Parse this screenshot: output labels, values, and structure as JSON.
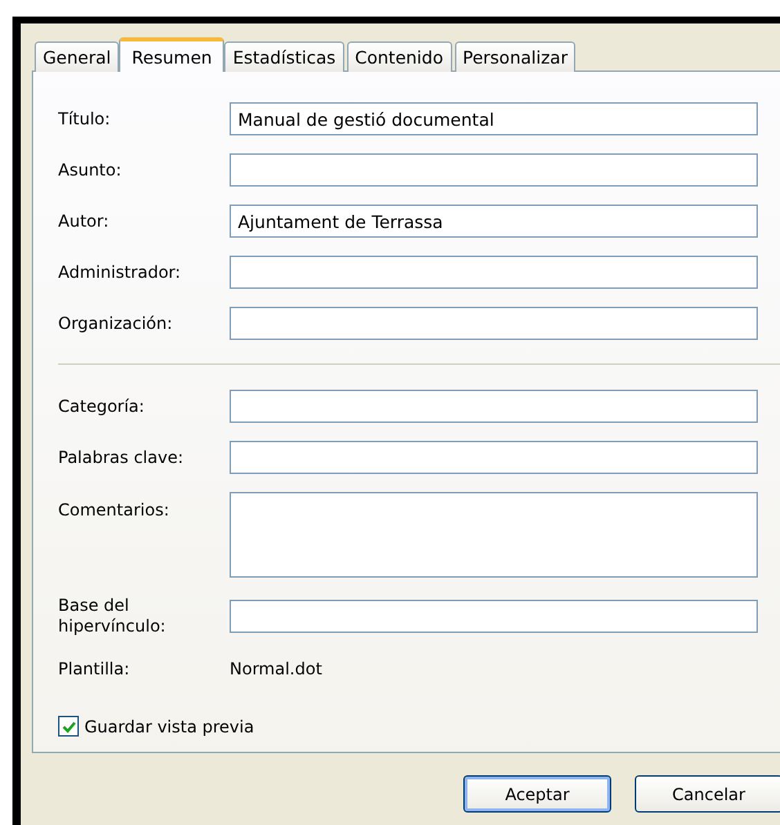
{
  "tabs": [
    {
      "label": "General",
      "selected": false
    },
    {
      "label": "Resumen",
      "selected": true
    },
    {
      "label": "Estadísticas",
      "selected": false
    },
    {
      "label": "Contenido",
      "selected": false
    },
    {
      "label": "Personalizar",
      "selected": false
    }
  ],
  "fields_top": [
    {
      "kind": "text",
      "label": "Título:",
      "value": "Manual de gestió documental"
    },
    {
      "kind": "text",
      "label": "Asunto:"
    },
    {
      "kind": "text",
      "label": "Autor:",
      "value": "Ajuntament de Terrassa"
    },
    {
      "kind": "text",
      "label": "Administrador:"
    },
    {
      "kind": "text",
      "label": "Organización:"
    }
  ],
  "fields_bottom": [
    {
      "kind": "text",
      "label": "Categoría:"
    },
    {
      "kind": "text",
      "label": "Palabras clave:"
    },
    {
      "kind": "textarea",
      "label": "Comentarios:"
    },
    {
      "kind": "text",
      "label": "Base del hipervínculo:"
    },
    {
      "kind": "static",
      "label": "Plantilla:",
      "value": "Normal.dot"
    }
  ],
  "preview_checkbox": {
    "label": "Guardar vista previa",
    "checked": true
  },
  "buttons": [
    {
      "label": "Aceptar",
      "default": true
    },
    {
      "label": "Cancelar",
      "default": false
    }
  ]
}
